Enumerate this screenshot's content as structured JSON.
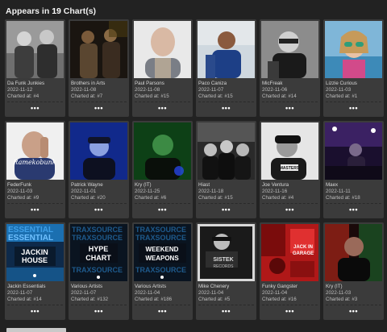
{
  "header": {
    "title_prefix": "Appears in",
    "count": "19",
    "title_suffix": "Chart(s)"
  },
  "more_label": "•••",
  "cards": [
    {
      "artist": "Da Funk Junkies",
      "date": "2022-11-12",
      "charted": "Charted at: #4",
      "image": "two-men-bw-photo"
    },
    {
      "artist": "Brothers in Arts",
      "date": "2022-11-08",
      "charted": "Charted at: #7",
      "image": "two-men-dark-photo"
    },
    {
      "artist": "Paul Parsons",
      "date": "2022-11-08",
      "charted": "Charted at: #15",
      "image": "bald-man-portrait"
    },
    {
      "artist": "Paco Caniza",
      "date": "2022-11-07",
      "charted": "Charted at: #15",
      "image": "man-blue-shirt-portrait"
    },
    {
      "artist": "MicFreak",
      "date": "2022-11-06",
      "charted": "Charted at: #14",
      "image": "man-glasses-bw-portrait"
    },
    {
      "artist": "Lizzie Curious",
      "date": "2022-11-03",
      "charted": "Charted at: #1",
      "image": "woman-sunglasses-portrait"
    },
    {
      "artist": "FederFunk",
      "date": "2022-11-03",
      "charted": "Charted at: #9",
      "image": "man-hand-on-face-portrait"
    },
    {
      "artist": "Patrick Wayne",
      "date": "2022-11-01",
      "charted": "Charted at: #20",
      "image": "man-cap-blue-light"
    },
    {
      "artist": "Kry (IT)",
      "date": "2022-11-25",
      "charted": "Charted at: #6",
      "image": "man-green-light-portrait"
    },
    {
      "artist": "Hiast",
      "date": "2022-11-18",
      "charted": "Charted at: #15",
      "image": "three-men-bw-photo"
    },
    {
      "artist": "Joe Ventura",
      "date": "2022-11-16",
      "charted": "Charted at: #4",
      "image": "man-cap-bw-portrait"
    },
    {
      "artist": "Maex",
      "date": "2022-11-11",
      "charted": "Charted at: #18",
      "image": "dj-stage-purple-lights"
    },
    {
      "artist": "Jackin Essentials",
      "date": "2022-11-07",
      "charted": "Charted at: #14",
      "image": "essential-jackin-house-cover",
      "cover_text": "ESSENTIAL JACKIN HOUSE"
    },
    {
      "artist": "Various Artists",
      "date": "2022-11-07",
      "charted": "Charted at: #132",
      "image": "hype-chart-cover",
      "cover_text": "HYPE CHART"
    },
    {
      "artist": "Various Artists",
      "date": "2022-11-04",
      "charted": "Charted at: #186",
      "image": "weekend-weapons-cover",
      "cover_text": "WEEKEND WEAPONS"
    },
    {
      "artist": "Mike Chenery",
      "date": "2022-11-04",
      "charted": "Charted at: #5",
      "image": "sistek-records-bw-cover"
    },
    {
      "artist": "Funky Gangster",
      "date": "2022-11-04",
      "charted": "Charted at: #16",
      "image": "red-collage-cover"
    },
    {
      "artist": "Kry (IT)",
      "date": "2022-11-03",
      "charted": "Charted at: #3",
      "image": "man-red-green-light-portrait"
    }
  ]
}
